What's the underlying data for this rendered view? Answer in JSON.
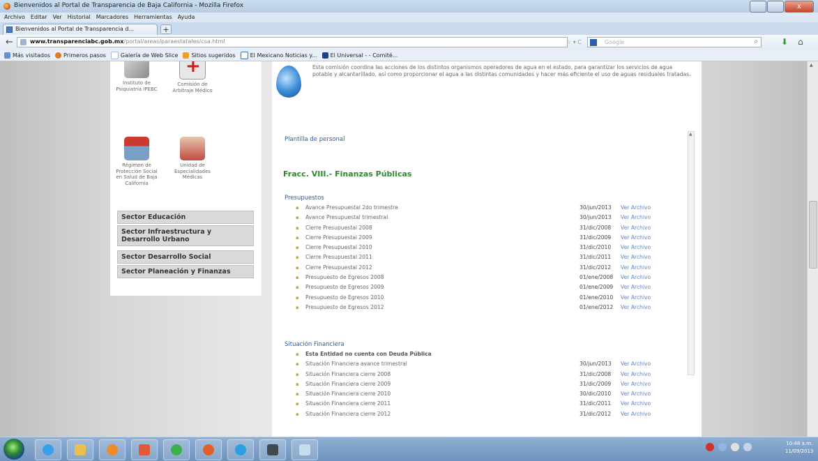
{
  "window": {
    "title": "Bienvenidos al Portal de Transparencia de Baja California - Mozilla Firefox",
    "close": "x"
  },
  "menu": [
    "Archivo",
    "Editar",
    "Ver",
    "Historial",
    "Marcadores",
    "Herramientas",
    "Ayuda"
  ],
  "tab": {
    "title": "Bienvenidos al Portal de Transparencia d...",
    "new_tab": "+"
  },
  "nav": {
    "url_domain": "www.transparenciabc.gob.mx",
    "url_path": "/portal/areas/paraestatales/csa.html",
    "search_engine": "Google",
    "search_placeholder": "Google"
  },
  "bookmarks": [
    {
      "label": "Más visitados",
      "color": "#6a8fd0"
    },
    {
      "label": "Primeros pasos",
      "color": "#e07b20"
    },
    {
      "label": "Galería de Web Slice",
      "color": "#9fbbe0"
    },
    {
      "label": "Sitios sugeridos",
      "color": "#f0a020"
    },
    {
      "label": "El Mexicano Noticias y...",
      "color": "#2b73c9"
    },
    {
      "label": "El Universal - - Comité...",
      "color": "#1c3f8c"
    }
  ],
  "left": {
    "institutions": [
      {
        "caption": "Instituto de Psiquiatría IPEBC"
      },
      {
        "caption": "Comisión de Arbitraje Médico"
      },
      {
        "caption": "Régimen de Protección Social en Salud de Baja California"
      },
      {
        "caption": "Unidad de Especialidades Médicas"
      }
    ],
    "sectors": [
      "Sector Educación",
      "Sector Infraestructura y Desarrollo Urbano",
      "Sector Desarrollo Social",
      "Sector Planeación y Finanzas"
    ]
  },
  "main": {
    "description": "Esta comisión coordina las acciones de los distintos organismos operadores de agua en el estado, para garantizar los servicios de agua potable y alcantarillado, así como proporcionar el agua a las distintas comunidades y hacer más eficiente el uso de aguas residuales tratadas.",
    "plantilla": "Plantilla de personal",
    "fracc_title": "Fracc. VIII.- Finanzas Públicas",
    "presupuestos": {
      "title": "Presupuestos",
      "rows": [
        {
          "name": "Avance Presupuestal 2do trimestre",
          "date": "30/jun/2013",
          "link": "Ver Archivo"
        },
        {
          "name": "Avance Presupuestal trimestral",
          "date": "30/jun/2013",
          "link": "Ver Archivo"
        },
        {
          "name": "Cierre Presupuestal 2008",
          "date": "31/dic/2008",
          "link": "Ver Archivo"
        },
        {
          "name": "Cierre Presupuestal 2009",
          "date": "31/dic/2009",
          "link": "Ver Archivo"
        },
        {
          "name": "Cierre Presupuestal 2010",
          "date": "31/dic/2010",
          "link": "Ver Archivo"
        },
        {
          "name": "Cierre Presupuestal 2011",
          "date": "31/dic/2011",
          "link": "Ver Archivo"
        },
        {
          "name": "Cierre Presupuestal 2012",
          "date": "31/dic/2012",
          "link": "Ver Archivo"
        },
        {
          "name": "Presupuesto de Egresos 2008",
          "date": "01/ene/2008",
          "link": "Ver Archivo"
        },
        {
          "name": "Presupuesto de Egresos 2009",
          "date": "01/ene/2009",
          "link": "Ver Archivo"
        },
        {
          "name": "Presupuesto de Egresos 2010",
          "date": "01/ene/2010",
          "link": "Ver Archivo"
        },
        {
          "name": "Presupuesto de Egresos 2012",
          "date": "01/ene/2012",
          "link": "Ver Archivo"
        }
      ]
    },
    "situacion": {
      "title": "Situación Financiera",
      "note": "Esta Entidad no cuenta con Deuda Pública",
      "rows": [
        {
          "name": "Situación Financiera avance trimestral",
          "date": "30/jun/2013",
          "link": "Ver Archivo"
        },
        {
          "name": "Situación Financiera cierre 2008",
          "date": "31/dic/2008",
          "link": "Ver Archivo"
        },
        {
          "name": "Situación Financiera cierre 2009",
          "date": "31/dic/2009",
          "link": "Ver Archivo"
        },
        {
          "name": "Situación Financiera cierre 2010",
          "date": "30/dic/2010",
          "link": "Ver Archivo"
        },
        {
          "name": "Situación Financiera cierre 2011",
          "date": "31/dic/2011",
          "link": "Ver Archivo"
        },
        {
          "name": "Situación Financiera cierre 2012",
          "date": "31/dic/2012",
          "link": "Ver Archivo"
        }
      ]
    }
  },
  "taskbar": {
    "clock_time": "10:48 a.m.",
    "clock_date": "11/09/2013",
    "apps": [
      {
        "icon": "ie-icon",
        "color": "#3aa0e8"
      },
      {
        "icon": "explorer-icon",
        "color": "#e8c04a"
      },
      {
        "icon": "media-player-icon",
        "color": "#f08a2a"
      },
      {
        "icon": "paint-icon",
        "color": "#e05a3a"
      },
      {
        "icon": "chrome-icon",
        "color": "#3cb04a"
      },
      {
        "icon": "firefox-icon",
        "color": "#e0602a"
      },
      {
        "icon": "skype-icon",
        "color": "#2aa0e0"
      },
      {
        "icon": "calculator-icon",
        "color": "#404850"
      },
      {
        "icon": "notepad-icon",
        "color": "#c8dcf0"
      }
    ]
  }
}
